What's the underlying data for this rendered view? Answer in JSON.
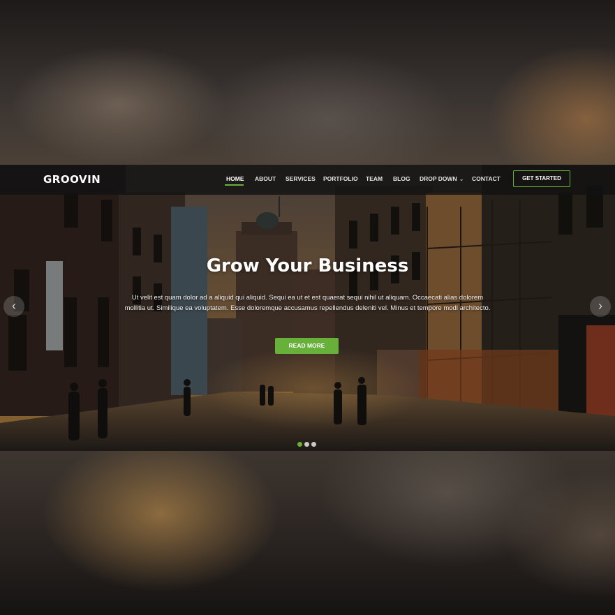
{
  "brand": {
    "logo": "GROOVIN"
  },
  "nav": {
    "items": [
      {
        "label": "HOME",
        "active": true
      },
      {
        "label": "ABOUT"
      },
      {
        "label": "SERVICES"
      },
      {
        "label": "PORTFOLIO"
      },
      {
        "label": "TEAM"
      },
      {
        "label": "BLOG"
      },
      {
        "label": "DROP DOWN",
        "has_dropdown": true
      },
      {
        "label": "CONTACT"
      }
    ],
    "cta_label": "GET STARTED"
  },
  "hero": {
    "title": "Grow Your Business",
    "description": "Ut velit est quam dolor ad a aliquid qui aliquid. Sequi ea ut et est quaerat sequi nihil ut aliquam. Occaecati alias dolorem mollitia ut. Similique ea voluptatem. Esse doloremque accusamus repellendus deleniti vel. Minus et tempore modi architecto.",
    "button_label": "READ MORE",
    "carousel": {
      "slide_count": 3,
      "active_index": 0
    }
  },
  "icons": {
    "prev": "chevron-left-icon",
    "next": "chevron-right-icon",
    "dropdown": "chevron-down-icon"
  },
  "colors": {
    "accent": "#67b03a",
    "header_bg": "#121212",
    "text": "#ffffff"
  }
}
